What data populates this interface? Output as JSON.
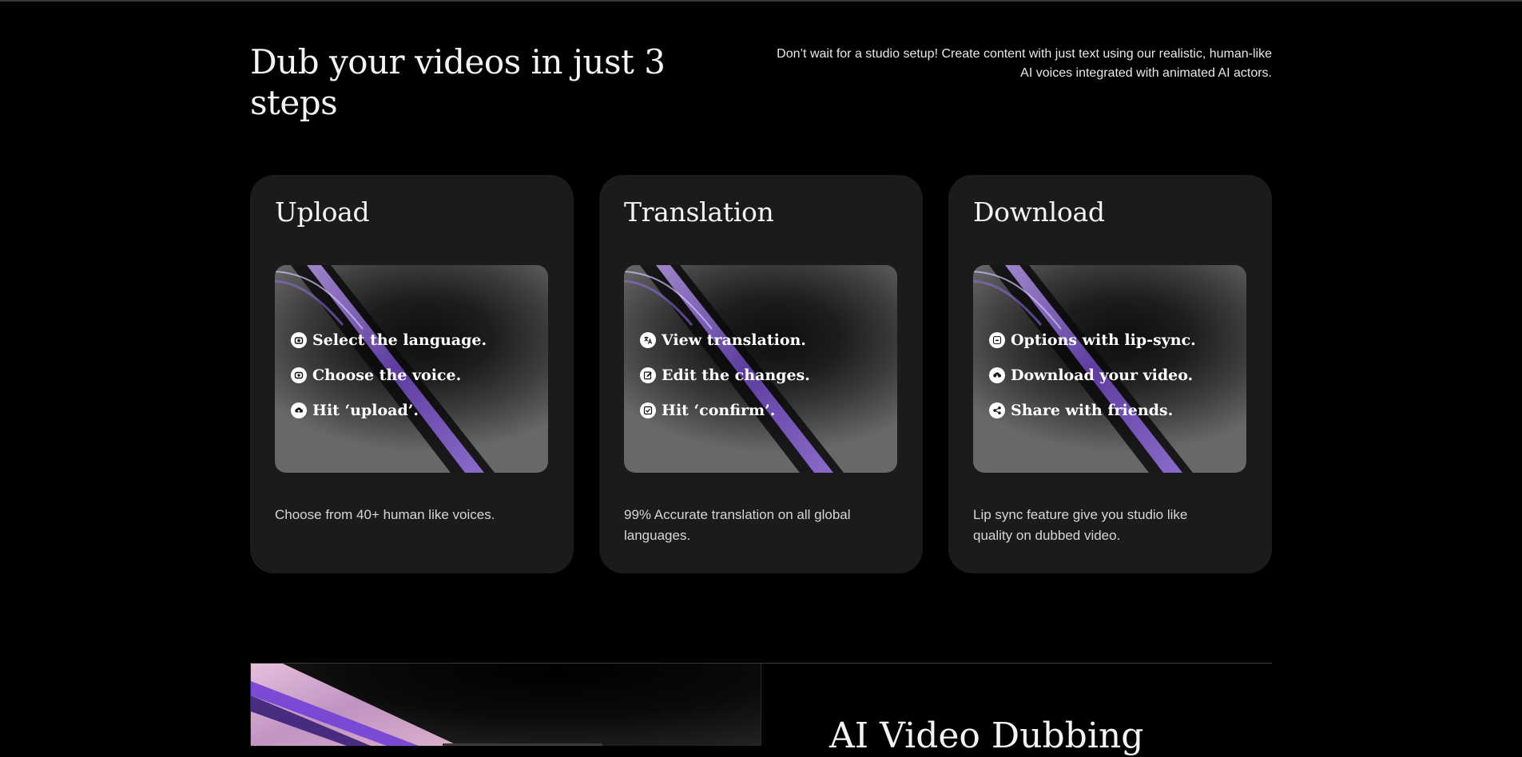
{
  "header": {
    "title": "Dub your videos in just 3 steps",
    "intro": "Don’t wait for a studio setup! Create content with just text using our realistic, human-like AI voices integrated with animated AI actors."
  },
  "cards": [
    {
      "title": "Upload",
      "steps": [
        {
          "icon": "camera-icon",
          "label": "Select the language."
        },
        {
          "icon": "record-icon",
          "label": "Choose the voice."
        },
        {
          "icon": "upload-cloud-icon",
          "label": "Hit ‘upload’."
        }
      ],
      "description": "Choose from 40+ human like voices."
    },
    {
      "title": "Translation",
      "steps": [
        {
          "icon": "translate-icon",
          "label": "View translation."
        },
        {
          "icon": "edit-icon",
          "label": "Edit the changes."
        },
        {
          "icon": "check-box-icon",
          "label": "Hit ‘confirm’."
        }
      ],
      "description": "99% Accurate translation on all global languages."
    },
    {
      "title": "Download",
      "steps": [
        {
          "icon": "lip-sync-icon",
          "label": "Options with lip-sync."
        },
        {
          "icon": "download-cloud-icon",
          "label": "Download your video."
        },
        {
          "icon": "share-icon",
          "label": "Share with friends."
        }
      ],
      "description": "Lip sync feature give you studio like quality on dubbed video."
    }
  ],
  "next_section": {
    "title": "AI Video Dubbing"
  },
  "colors": {
    "background": "#000000",
    "card": "#1b1b1b",
    "accent_purple": "#7b52c9"
  }
}
